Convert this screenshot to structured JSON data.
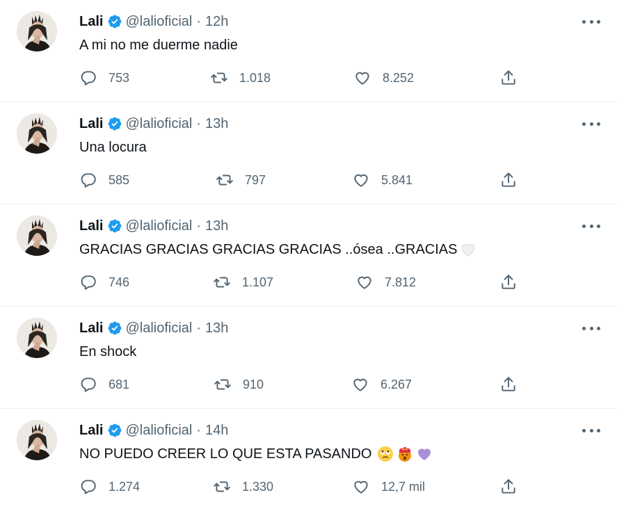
{
  "tweets": [
    {
      "name": "Lali",
      "handle": "@lalioficial",
      "time": "12h",
      "text": "A mi no me duerme nadie",
      "emojis": [],
      "replies": "753",
      "retweets": "1.018",
      "likes": "8.252"
    },
    {
      "name": "Lali",
      "handle": "@lalioficial",
      "time": "13h",
      "text": "Una locura",
      "emojis": [],
      "replies": "585",
      "retweets": "797",
      "likes": "5.841"
    },
    {
      "name": "Lali",
      "handle": "@lalioficial",
      "time": "13h",
      "text": "GRACIAS GRACIAS GRACIAS GRACIAS ..ósea ..GRACIAS",
      "emojis": [
        "white-heart"
      ],
      "replies": "746",
      "retweets": "1.107",
      "likes": "7.812"
    },
    {
      "name": "Lali",
      "handle": "@lalioficial",
      "time": "13h",
      "text": "En shock",
      "emojis": [],
      "replies": "681",
      "retweets": "910",
      "likes": "6.267"
    },
    {
      "name": "Lali",
      "handle": "@lalioficial",
      "time": "14h",
      "text": "NO PUEDO CREER LO QUE ESTA PASANDO",
      "emojis": [
        "rolling-eyes-emoji",
        "exploding-head-emoji",
        "purple-heart"
      ],
      "replies": "1.274",
      "retweets": "1.330",
      "likes": "12,7 mil"
    }
  ],
  "separator": "·",
  "colors": {
    "text": "#0f1419",
    "secondary": "#536471",
    "verified": "#1d9bf0",
    "divider": "#eff3f4"
  },
  "icons": {
    "reply": "reply-icon",
    "retweet": "retweet-icon",
    "like": "heart-icon",
    "share": "share-icon",
    "more": "more-icon",
    "verified": "verified-badge-icon"
  }
}
